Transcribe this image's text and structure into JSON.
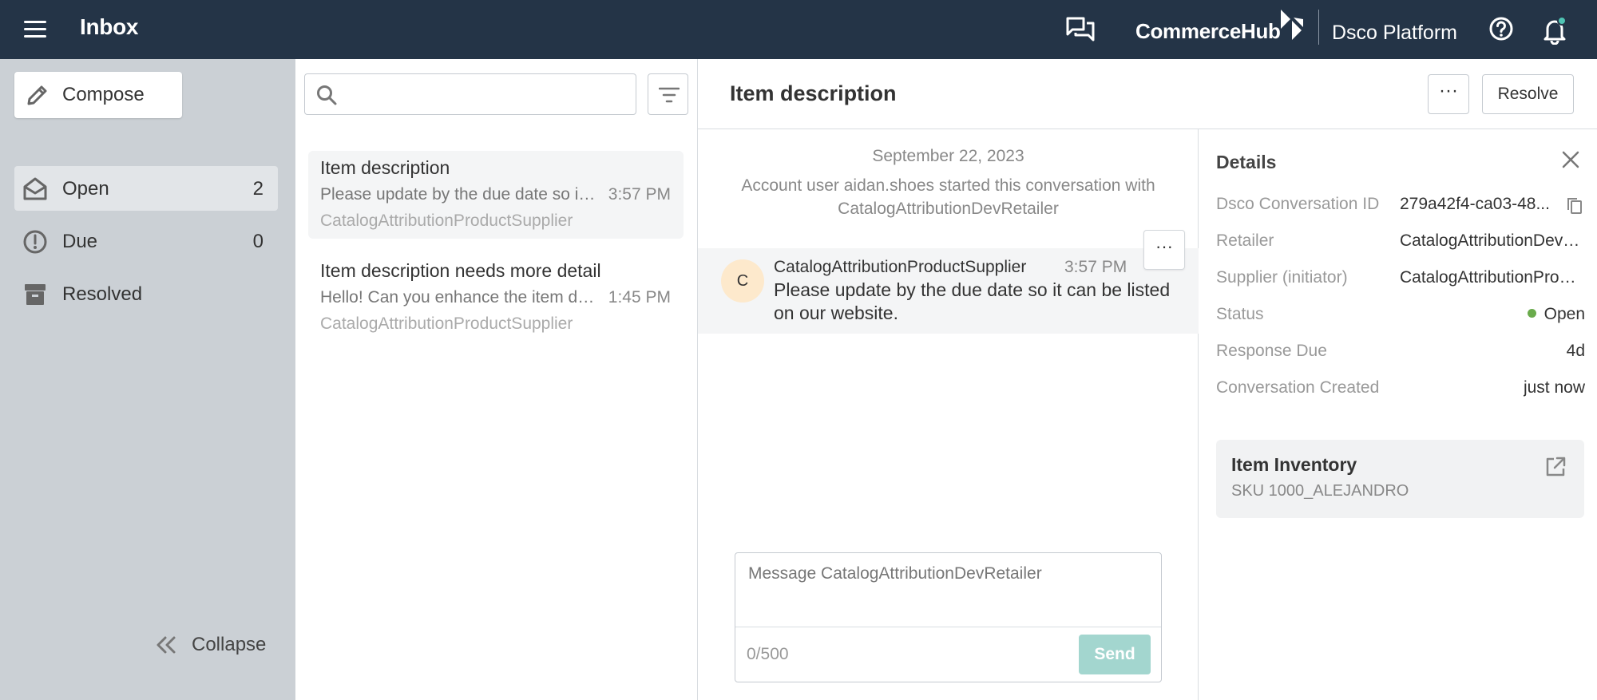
{
  "topbar": {
    "app_title": "Inbox",
    "brand": "CommerceHub",
    "platform": "Dsco Platform",
    "colors": {
      "background": "#243447",
      "notification_dot": "#4fc3b3"
    }
  },
  "sidebar": {
    "compose_label": "Compose",
    "items": [
      {
        "label": "Open",
        "count": "2",
        "icon": "envelope-open-icon",
        "active": true
      },
      {
        "label": "Due",
        "count": "0",
        "icon": "alert-circle-icon",
        "active": false
      },
      {
        "label": "Resolved",
        "count": "",
        "icon": "archive-icon",
        "active": false
      }
    ],
    "collapse_label": "Collapse"
  },
  "list": {
    "search": {
      "value": "",
      "placeholder": ""
    },
    "conversations": [
      {
        "subject": "Item description",
        "preview": "Please update by the due date so it can be listed on our website.",
        "time": "3:57 PM",
        "from": "CatalogAttributionProductSupplier",
        "active": true
      },
      {
        "subject": "Item description needs more detail",
        "preview": "Hello! Can you enhance the item description?",
        "time": "1:45 PM",
        "from": "CatalogAttributionProductSupplier",
        "active": false
      }
    ]
  },
  "conversation": {
    "title": "Item description",
    "more_label": "···",
    "resolve_label": "Resolve",
    "date": "September 22, 2023",
    "started_text": "Account user aidan.shoes started this conversation with CatalogAttributionDevRetailer",
    "messages": [
      {
        "avatar_initial": "C",
        "sender": "CatalogAttributionProductSupplier",
        "time": "3:57 PM",
        "body": "Please update by the due date so it can be listed on our website."
      }
    ],
    "composer": {
      "placeholder": "Message CatalogAttributionDevRetailer",
      "value": "",
      "counter": "0/500",
      "send_label": "Send"
    }
  },
  "details": {
    "title": "Details",
    "rows": [
      {
        "key": "Dsco Conversation ID",
        "value": "279a42f4-ca03-48..."
      },
      {
        "key": "Retailer",
        "value": "CatalogAttributionDevRetailer"
      },
      {
        "key": "Supplier (initiator)",
        "value": "CatalogAttributionProductSupplier"
      },
      {
        "key": "Status",
        "value": "Open",
        "status_color": "#6aab4c"
      },
      {
        "key": "Response Due",
        "value": "4d"
      },
      {
        "key": "Conversation Created",
        "value": "just now"
      }
    ],
    "inventory": {
      "title": "Item Inventory",
      "sku": "SKU 1000_ALEJANDRO"
    }
  }
}
